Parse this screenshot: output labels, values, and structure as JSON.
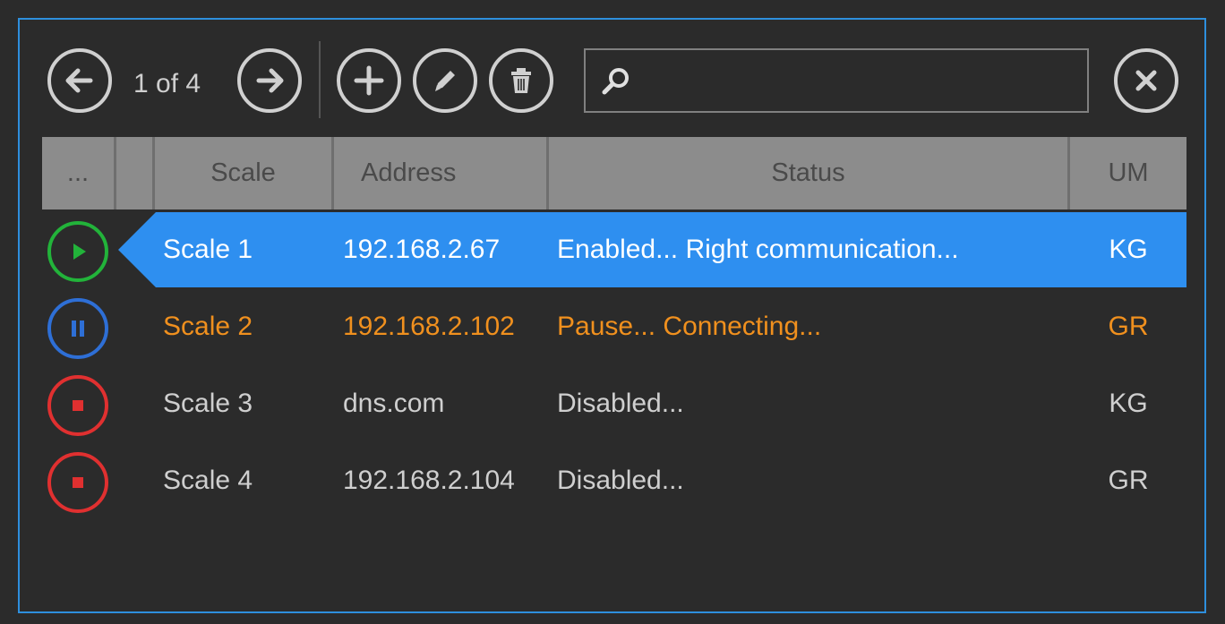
{
  "toolbar": {
    "pager_text": "1 of 4",
    "search": {
      "value": "",
      "placeholder": ""
    }
  },
  "columns": [
    "...",
    "",
    "Scale",
    "Address",
    "Status",
    "UM"
  ],
  "rows": [
    {
      "name": "Scale 1",
      "address": "192.168.2.67",
      "status": "Enabled...  Right communication...",
      "um": "KG",
      "state": "play",
      "selected": true,
      "text_color": "#ffffff",
      "icon_color": "#22b33a"
    },
    {
      "name": "Scale 2",
      "address": "192.168.2.102",
      "status": "Pause...  Connecting...",
      "um": "GR",
      "state": "pause",
      "selected": false,
      "text_color": "#f0901e",
      "icon_color": "#2e6fd6"
    },
    {
      "name": "Scale 3",
      "address": "dns.com",
      "status": "Disabled...",
      "um": "KG",
      "state": "stop",
      "selected": false,
      "text_color": "#cfcfcf",
      "icon_color": "#e03030"
    },
    {
      "name": "Scale 4",
      "address": "192.168.2.104",
      "status": "Disabled...",
      "um": "GR",
      "state": "stop",
      "selected": false,
      "text_color": "#cfcfcf",
      "icon_color": "#e03030"
    }
  ],
  "colors": {
    "accent": "#2e8fdd",
    "selection": "#2e8ff0",
    "header_bg": "#8c8c8c",
    "background": "#2b2b2b"
  },
  "icons": [
    "arrow-left-icon",
    "arrow-right-icon",
    "plus-icon",
    "pencil-icon",
    "trash-icon",
    "search-icon",
    "close-icon",
    "play-icon",
    "pause-icon",
    "stop-icon"
  ]
}
